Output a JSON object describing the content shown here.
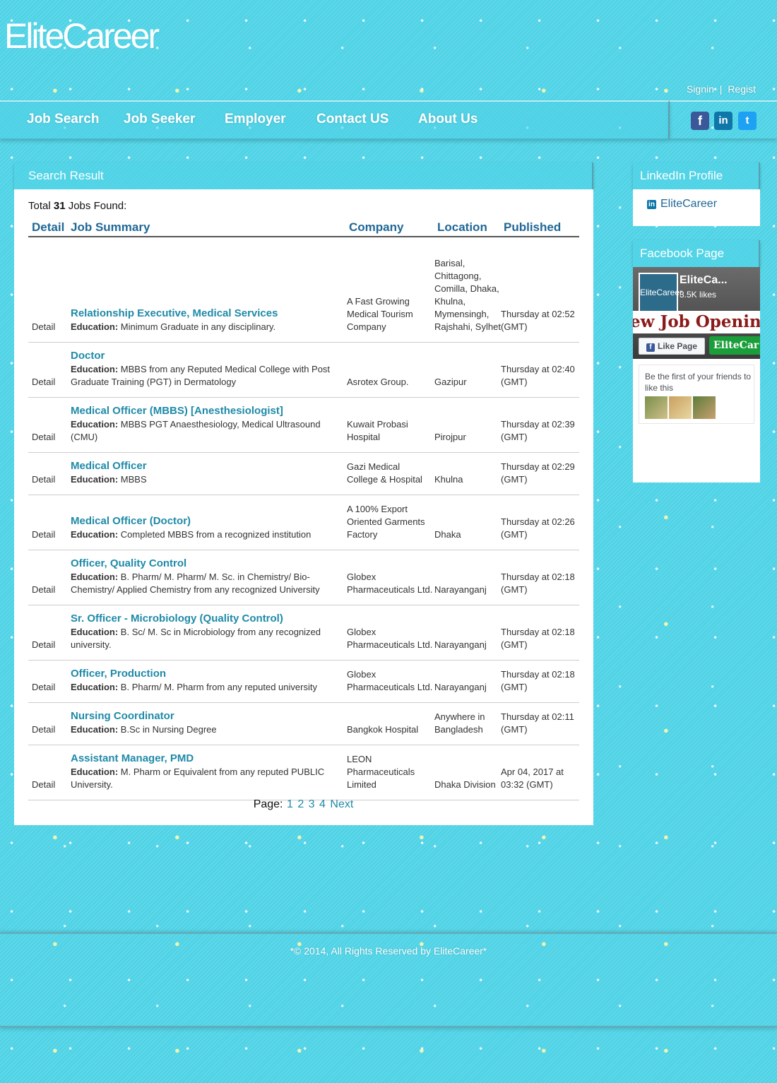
{
  "brand": {
    "logo": "EliteCareer"
  },
  "auth": {
    "signin": "Signin",
    "separator": "|",
    "register": "Regist"
  },
  "nav": [
    {
      "label": "Job Search"
    },
    {
      "label": "Job Seeker"
    },
    {
      "label": "Employer"
    },
    {
      "label": "Contact US"
    },
    {
      "label": "About Us"
    }
  ],
  "social": {
    "facebook": "f",
    "linkedin": "in",
    "twitter": "t"
  },
  "search": {
    "heading": "Search Result",
    "total_prefix": "Total",
    "total_count": "31",
    "total_suffix": "Jobs Found:",
    "columns": {
      "detail": "Detail",
      "summary": "Job Summary",
      "company": "Company",
      "location": "Location",
      "published": "Published"
    },
    "detail_label": "Detail",
    "education_label": "Education:",
    "jobs": [
      {
        "title": "Relationship Executive, Medical Services",
        "education": "Minimum Graduate in any disciplinary.",
        "company": "A Fast Growing Medical Tourism Company",
        "location": "Barisal, Chittagong, Comilla, Dhaka, Khulna, Mymensingh, Rajshahi, Sylhet",
        "published": "Thursday at 02:52 (GMT)"
      },
      {
        "title": "Doctor",
        "education": "MBBS from any Reputed Medical College with Post Graduate Training (PGT) in Dermatology",
        "company": "Asrotex Group.",
        "location": "Gazipur",
        "published": "Thursday at 02:40 (GMT)"
      },
      {
        "title": "Medical Officer (MBBS) [Anesthesiologist]",
        "education": "MBBS PGT Anaesthesiology, Medical Ultrasound (CMU)",
        "company": "Kuwait Probasi Hospital",
        "location": "Pirojpur",
        "published": "Thursday at 02:39 (GMT)"
      },
      {
        "title": "Medical Officer",
        "education": "MBBS",
        "company": "Gazi Medical College & Hospital",
        "location": "Khulna",
        "published": "Thursday at 02:29 (GMT)"
      },
      {
        "title": "Medical Officer (Doctor)",
        "education": "Completed MBBS from a recognized institution",
        "company": "A 100% Export Oriented Garments Factory",
        "location": "Dhaka",
        "published": "Thursday at 02:26 (GMT)"
      },
      {
        "title": "Officer, Quality Control",
        "education": "B. Pharm/ M. Pharm/ M. Sc. in Chemistry/ Bio-Chemistry/ Applied Chemistry from any recognized University",
        "company": "Globex Pharmaceuticals Ltd.",
        "location": "Narayanganj",
        "published": "Thursday at 02:18 (GMT)"
      },
      {
        "title": "Sr. Officer - Microbiology (Quality Control)",
        "education": "B. Sc/ M. Sc in Microbiology from any recognized university.",
        "company": "Globex Pharmaceuticals Ltd.",
        "location": "Narayanganj",
        "published": "Thursday at 02:18 (GMT)"
      },
      {
        "title": "Officer, Production",
        "education": "B. Pharm/ M. Pharm from any reputed university",
        "company": "Globex Pharmaceuticals Ltd.",
        "location": "Narayanganj",
        "published": "Thursday at 02:18 (GMT)"
      },
      {
        "title": "Nursing Coordinator",
        "education": "B.Sc in Nursing Degree",
        "company": "Bangkok Hospital",
        "location": "Anywhere in Bangladesh",
        "published": "Thursday at 02:11 (GMT)"
      },
      {
        "title": "Assistant Manager, PMD",
        "education": "M. Pharm or Equivalent from any reputed PUBLIC University.",
        "company": "LEON Pharmaceuticals Limited",
        "location": "Dhaka Division",
        "published": "Apr 04, 2017 at 03:32 (GMT)"
      }
    ],
    "pager": {
      "label": "Page:",
      "pages": [
        "1",
        "2",
        "3",
        "4"
      ],
      "next": "Next"
    }
  },
  "linkedin": {
    "heading": "LinkedIn Profile",
    "link": "EliteCareer",
    "badge": "in"
  },
  "facebook": {
    "heading": "Facebook Page",
    "page_name": "EliteCa...",
    "likes": "3.5K likes",
    "avatar_text": "EliteCareer",
    "banner": "ew Job Openin",
    "like_button": "Like Page",
    "cta_button": "EliteCar",
    "friends_text": "Be the first of your friends to like this"
  },
  "footer": {
    "text": "*© 2014, All Rights Reserved by EliteCareer*"
  }
}
